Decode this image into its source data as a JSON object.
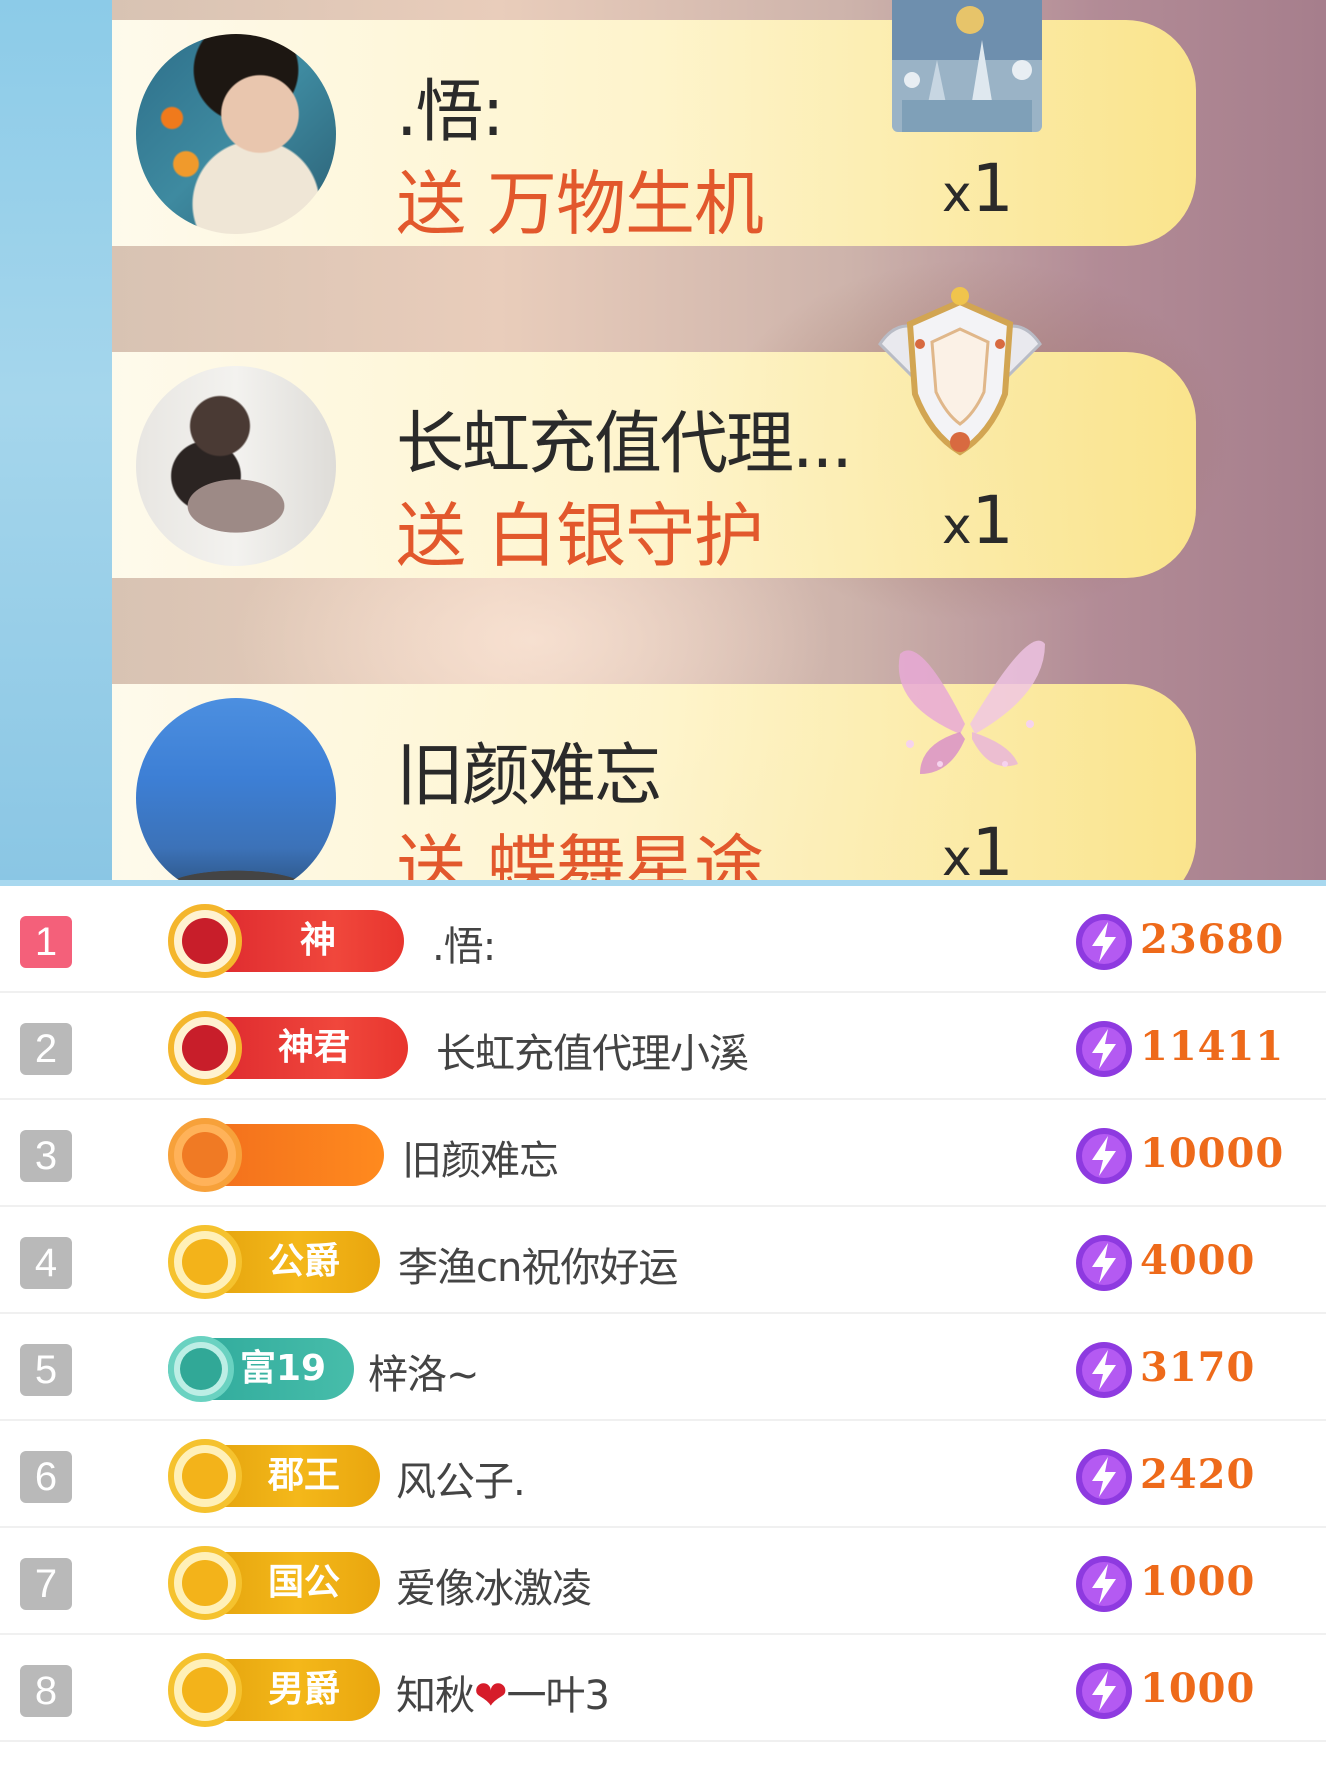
{
  "gift_feed": [
    {
      "sender": ".悟:",
      "send_word": "送",
      "gift_name": "万物生机",
      "count_prefix": "x",
      "count": "1",
      "gift_icon": "castle-scene-icon"
    },
    {
      "sender": "长虹充值代理...",
      "send_word": "送",
      "gift_name": "白银守护",
      "count_prefix": "x",
      "count": "1",
      "gift_icon": "silver-shield-icon"
    },
    {
      "sender": "旧颜难忘",
      "send_word": "送",
      "gift_name": "蝶舞星途",
      "count_prefix": "x",
      "count": "1",
      "gift_icon": "butterfly-icon"
    }
  ],
  "ranking": [
    {
      "rank": "1",
      "badge": "神",
      "badge_style": "red",
      "name": ".悟:",
      "score": "23680"
    },
    {
      "rank": "2",
      "badge": "神君",
      "badge_style": "red",
      "name": "长虹充值代理小溪",
      "score": "11411"
    },
    {
      "rank": "3",
      "badge": "",
      "badge_style": "orange",
      "name": "旧颜难忘",
      "score": "10000"
    },
    {
      "rank": "4",
      "badge": "公爵",
      "badge_style": "gold",
      "name": "李渔cn祝你好运",
      "score": "4000"
    },
    {
      "rank": "5",
      "badge": "富19",
      "badge_style": "teal",
      "name": "梓洛~",
      "score": "3170"
    },
    {
      "rank": "6",
      "badge": "郡王",
      "badge_style": "gold",
      "name": "风公子.",
      "score": "2420"
    },
    {
      "rank": "7",
      "badge": "国公",
      "badge_style": "gold",
      "name": "爱像冰激凌",
      "score": "1000"
    },
    {
      "rank": "8",
      "badge": "男爵",
      "badge_style": "gold",
      "name_prefix": "知秋",
      "name_heart": "❤",
      "name_suffix": "一叶3",
      "score": "1000"
    }
  ],
  "colors": {
    "accent_orange": "#ee6a1a",
    "gift_text": "#e2582c",
    "rank_top": "#f4607a",
    "rank_default": "#b9b9b9",
    "bolt_purple": "#8e3ae0"
  }
}
